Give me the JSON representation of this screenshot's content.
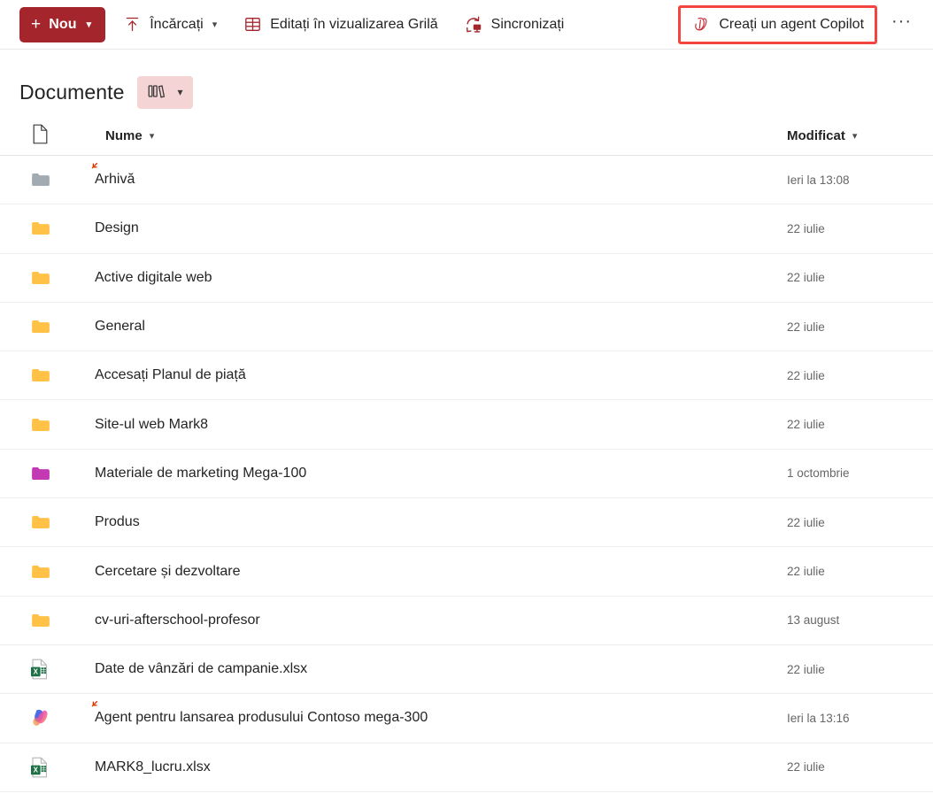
{
  "toolbar": {
    "new_label": "Nou",
    "new_icon": "plus-icon",
    "upload_label": "Încărcați",
    "upload_icon": "upload-arrow-icon",
    "grid_edit_label": "Editați în vizualizarea Grilă",
    "grid_edit_icon": "grid-table-icon",
    "sync_label": "Sincronizați",
    "sync_icon": "sync-refresh-icon",
    "copilot_agent_label": "Creați un agent Copilot",
    "copilot_agent_icon": "copilot-outline-icon",
    "more_label": "···",
    "more_icon": "more-ellipsis-icon",
    "chevron": "⌄",
    "accent_color": "#A4262C",
    "highlight_color": "#F4443E"
  },
  "library": {
    "title": "Documente",
    "badge_icon": "library-columns-icon",
    "badge_color": "#F4D4D4",
    "badge_chevron": "⌄"
  },
  "columns": {
    "icon_header": "file-type-icon",
    "name": "Nume",
    "modified": "Modificat",
    "chevron": "⌄"
  },
  "items": [
    {
      "name": "Arhivă",
      "modified": "Ieri la 13:08",
      "icon": "folder-gray-icon",
      "type": "folder",
      "color": "#A3ABB2",
      "new": true
    },
    {
      "name": "Design",
      "modified": "22 iulie",
      "icon": "folder-yellow-icon",
      "type": "folder",
      "color": "#FFC247",
      "new": false
    },
    {
      "name": "Active digitale web",
      "modified": "22 iulie",
      "icon": "folder-yellow-icon",
      "type": "folder",
      "color": "#FFC247",
      "new": false
    },
    {
      "name": "General",
      "modified": "22 iulie",
      "icon": "folder-yellow-icon",
      "type": "folder",
      "color": "#FFC247",
      "new": false
    },
    {
      "name": "Accesați Planul de piață",
      "modified": "22 iulie",
      "icon": "folder-yellow-icon",
      "type": "folder",
      "color": "#FFC247",
      "new": false
    },
    {
      "name": "Site-ul web Mark8",
      "modified": "22 iulie",
      "icon": "folder-yellow-icon",
      "type": "folder",
      "color": "#FFC247",
      "new": false
    },
    {
      "name": "Materiale de marketing Mega-100",
      "modified": "1 octombrie",
      "icon": "folder-magenta-icon",
      "type": "folder",
      "color": "#C239B3",
      "new": false
    },
    {
      "name": "Produs",
      "modified": "22 iulie",
      "icon": "folder-yellow-icon",
      "type": "folder",
      "color": "#FFC247",
      "new": false
    },
    {
      "name": "Cercetare și dezvoltare",
      "modified": "22 iulie",
      "icon": "folder-yellow-icon",
      "type": "folder",
      "color": "#FFC247",
      "new": false
    },
    {
      "name": "cv-uri-afterschool-profesor",
      "modified": "13 august",
      "icon": "folder-yellow-icon",
      "type": "folder",
      "color": "#FFC247",
      "new": false
    },
    {
      "name": "Date de vânzări de campanie.xlsx",
      "modified": "22 iulie",
      "icon": "excel-file-icon",
      "type": "excel",
      "color": "#1D7044",
      "new": false
    },
    {
      "name": "Agent pentru lansarea produsului Contoso mega-300",
      "modified": "Ieri la 13:16",
      "icon": "copilot-agent-icon",
      "type": "copilot",
      "color": "#C252D4",
      "new": true
    },
    {
      "name": "MARK8_lucru.xlsx",
      "modified": "22 iulie",
      "icon": "excel-file-icon",
      "type": "excel",
      "color": "#1D7044",
      "new": false
    }
  ]
}
